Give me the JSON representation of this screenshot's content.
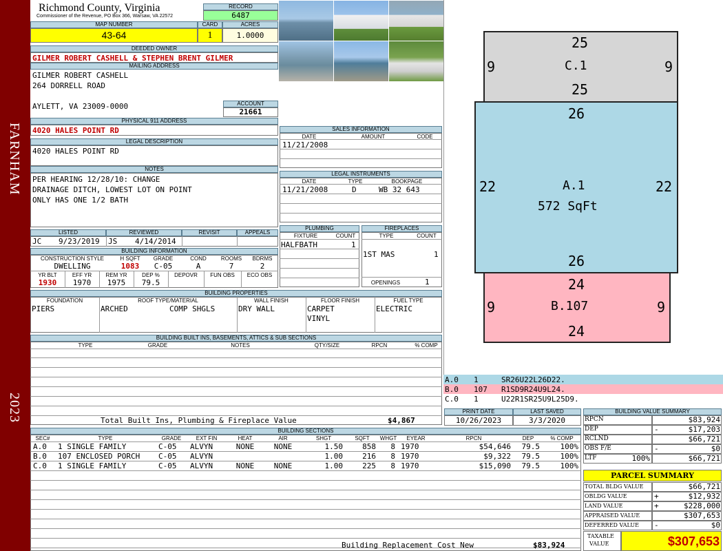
{
  "sidebar": {
    "district": "FARNHAM",
    "year": "2023"
  },
  "header": {
    "county": "Richmond County, Virginia",
    "commissioner": "Commissioner of the Revenue, PO Box 366, Warsaw, VA 22572"
  },
  "record": {
    "label": "RECORD",
    "value": "6487"
  },
  "map": {
    "label": "MAP NUMBER",
    "value": "43-64",
    "card_label": "CARD",
    "card": "1",
    "acres_label": "ACRES",
    "acres": "1.0000"
  },
  "owner": {
    "deeded_label": "DEEDED OWNER",
    "deeded": "GILMER ROBERT CASHELL & STEPHEN BRENT GILMER",
    "mailing_label": "MAILING ADDRESS",
    "line1": "GILMER ROBERT CASHELL",
    "line2": "264 DORRELL ROAD",
    "line3": "AYLETT, VA 23009-0000",
    "account_label": "ACCOUNT",
    "account": "21661"
  },
  "physical": {
    "label": "PHYSICAL 911 ADDRESS",
    "value": "4020 HALES POINT RD"
  },
  "legal": {
    "label": "LEGAL DESCRIPTION",
    "value": "4020 HALES POINT RD"
  },
  "notes": {
    "label": "NOTES",
    "lines": [
      "PER HEARING 12/28/10: CHANGE",
      "DRAINAGE DITCH, LOWEST LOT ON POINT",
      "ONLY HAS ONE 1/2 BATH"
    ]
  },
  "visits": {
    "listed_label": "LISTED",
    "reviewed_label": "REVIEWED",
    "revisit_label": "REVISIT",
    "appeals_label": "APPEALS",
    "listed_by": "JC",
    "listed_date": "9/23/2019",
    "reviewed_by": "JS",
    "reviewed_date": "4/14/2014"
  },
  "building_info": {
    "label": "BUILDING INFORMATION",
    "h": [
      "CONSTRUCTION STYLE",
      "H SQFT",
      "GRADE",
      "COND",
      "ROOMS",
      "BDRMS"
    ],
    "v": [
      "DWELLING",
      "1083",
      "C-05",
      "A",
      "7",
      "2"
    ],
    "h2": [
      "YR BLT",
      "EFF YR",
      "REM YR",
      "DEP %",
      "DEPOVR",
      "FUN OBS",
      "ECO OBS"
    ],
    "v2": [
      "1930",
      "1970",
      "1975",
      "79.5",
      "",
      "",
      ""
    ]
  },
  "sales": {
    "label": "SALES INFORMATION",
    "h": [
      "DATE",
      "AMOUNT",
      "CODE"
    ],
    "date": "11/21/2008"
  },
  "instruments": {
    "label": "LEGAL INSTRUMENTS",
    "h": [
      "DATE",
      "TYPE",
      "BOOKPAGE"
    ],
    "date": "11/21/2008",
    "type": "D",
    "book": "WB 32 643"
  },
  "plumbing": {
    "label": "PLUMBING",
    "h": [
      "FIXTURE",
      "COUNT"
    ],
    "fixture": "HALFBATH",
    "count": "1"
  },
  "fireplaces": {
    "label": "FIREPLACES",
    "h": [
      "TYPE",
      "COUNT"
    ],
    "type": "1ST MAS",
    "count": "1",
    "openings_label": "OPENINGS",
    "openings": "1"
  },
  "properties": {
    "label": "BUILDING PROPERTIES",
    "h": [
      "FOUNDATION",
      "ROOF TYPE/MATERIAL",
      "WALL FINISH",
      "FLOOR FINISH",
      "FUEL TYPE"
    ],
    "foundation": "PIERS",
    "roof_type": "ARCHED",
    "roof_mat": "COMP SHGLS",
    "wall": "DRY WALL",
    "floor1": "CARPET",
    "floor2": "VINYL",
    "fuel": "ELECTRIC"
  },
  "builtins": {
    "label": "BUILDING BUILT INS, BASEMENTS, ATTICS & SUB SECTIONS",
    "h": [
      "TYPE",
      "GRADE",
      "NOTES",
      "QTY/SIZE",
      "RPCN",
      "% COMP"
    ],
    "total_label": "Total Built Ins, Plumbing & Fireplace Value",
    "total": "$4,867"
  },
  "sections": {
    "label": "BUILDING SECTIONS",
    "h": [
      "SEC#",
      "TYPE",
      "GRADE",
      "EXT FIN",
      "HEAT",
      "AIR",
      "SHGT",
      "SQFT",
      "WHGT",
      "EYEAR",
      "RPCN",
      "DEP",
      "% COMP"
    ],
    "rows": [
      [
        "A.0",
        "1 SINGLE FAMILY",
        "C-05",
        "ALVYN",
        "NONE",
        "NONE",
        "1.50",
        "858",
        "8",
        "1970",
        "$54,646",
        "79.5",
        "100%"
      ],
      [
        "B.0",
        "107 ENCLOSED PORCH",
        "C-05",
        "ALVYN",
        "",
        "",
        "1.00",
        "216",
        "8",
        "1970",
        "$9,322",
        "79.5",
        "100%"
      ],
      [
        "C.0",
        "1 SINGLE FAMILY",
        "C-05",
        "ALVYN",
        "NONE",
        "NONE",
        "1.00",
        "225",
        "8",
        "1970",
        "$15,090",
        "79.5",
        "100%"
      ]
    ],
    "replacement_label": "Building Replacement Cost New",
    "replacement": "$83,924"
  },
  "sketch": {
    "c": {
      "top": "25",
      "left": "9",
      "right": "9",
      "label": "C.1",
      "bottom": "25",
      "color": "#d6d6d6"
    },
    "a": {
      "top": "26",
      "left": "22",
      "right": "22",
      "label": "A.1",
      "area": "572 SqFt",
      "bottom": "26",
      "color": "#add8e6"
    },
    "b": {
      "top": "24",
      "left": "9",
      "right": "9",
      "label": "B.107",
      "bottom": "24",
      "color": "#ffb6c1"
    },
    "legend": [
      [
        "A.0",
        "1",
        "SR26U22L26D22."
      ],
      [
        "B.0",
        "107",
        "R1SD9R24U9L24."
      ],
      [
        "C.0",
        "1",
        "U22R1SR25U9L25D9."
      ]
    ]
  },
  "dates": {
    "print_label": "PRINT DATE",
    "print": "10/26/2023",
    "saved_label": "LAST SAVED",
    "saved": "3/3/2020"
  },
  "bvs": {
    "label": "BUILDING VALUE SUMMARY",
    "rows": [
      [
        "RPCN",
        "",
        "$83,924"
      ],
      [
        "DEP",
        "-",
        "$17,203"
      ],
      [
        "RCLND",
        "",
        "$66,721"
      ],
      [
        "OBS F/E",
        "-",
        "$0"
      ],
      [
        "LTF",
        "100%",
        "$66,721"
      ]
    ]
  },
  "parcel": {
    "label": "PARCEL SUMMARY",
    "rows": [
      [
        "TOTAL BLDG VALUE",
        "",
        "$66,721"
      ],
      [
        "OBLDG VALUE",
        "+",
        "$12,932"
      ],
      [
        "LAND VALUE",
        "+",
        "$228,000"
      ],
      [
        "APPRAISED VALUE",
        "",
        "$307,653"
      ],
      [
        "DEFERRED VALUE",
        "-",
        "$0"
      ]
    ],
    "taxable_label1": "TAXABLE",
    "taxable_label2": "VALUE",
    "taxable": "$307,653"
  }
}
